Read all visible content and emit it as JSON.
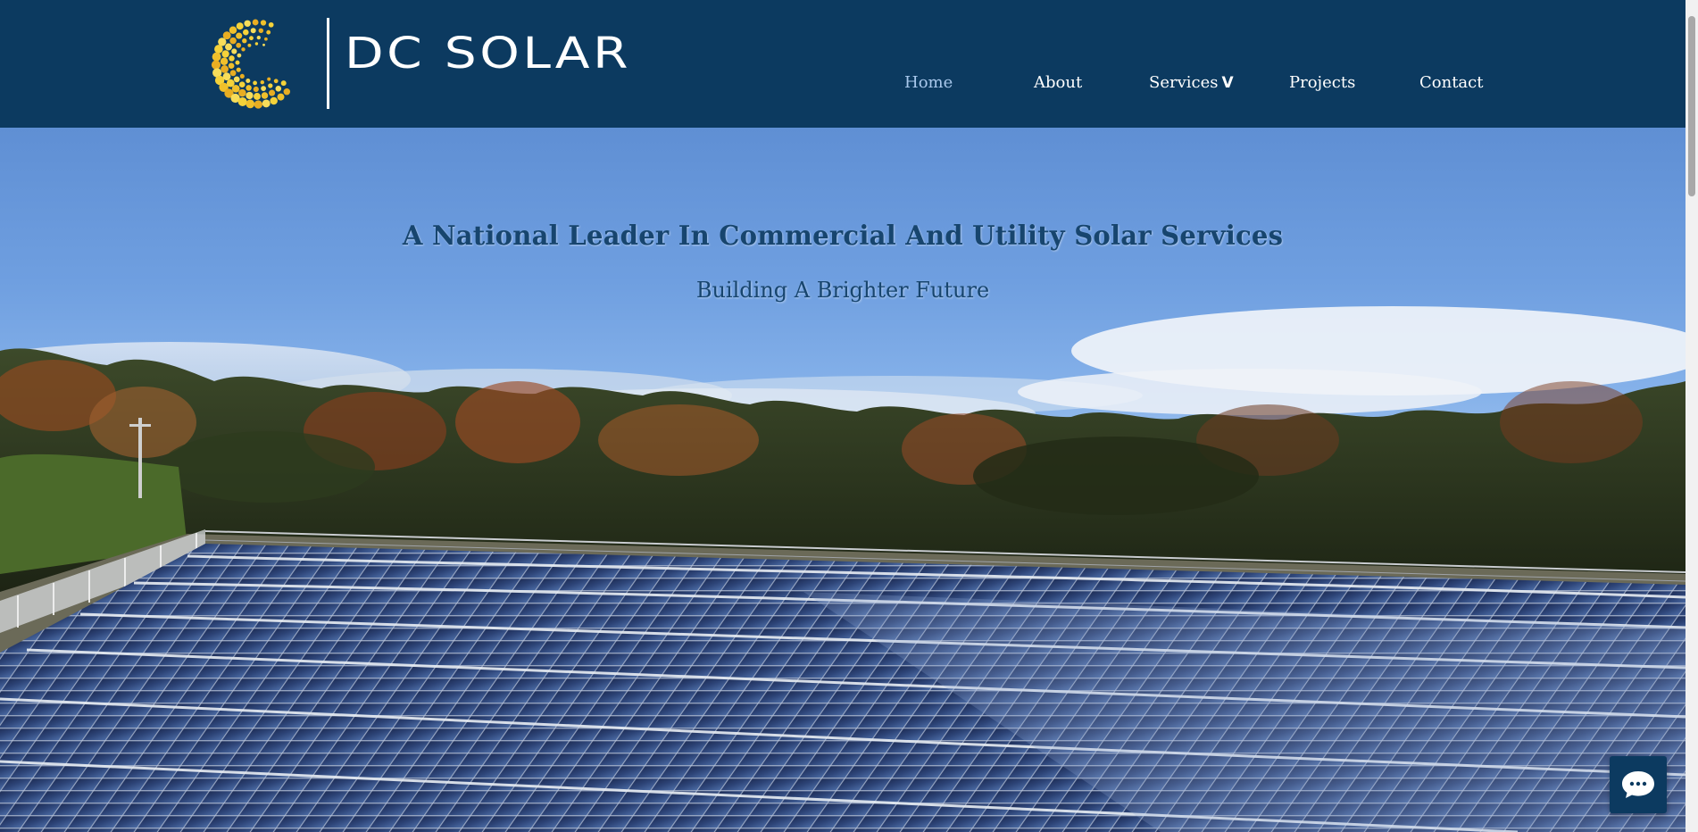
{
  "brand": {
    "name": "DC SOLAR",
    "logo_icon": "sun-dots-logo"
  },
  "nav": {
    "items": [
      {
        "label": "Home",
        "active": true
      },
      {
        "label": "About",
        "active": false
      },
      {
        "label": "Services",
        "active": false,
        "has_dropdown": true,
        "chevron": "V"
      },
      {
        "label": "Projects",
        "active": false
      },
      {
        "label": "Contact",
        "active": false
      }
    ]
  },
  "hero": {
    "title": "A National Leader In Commercial And Utility Solar Services",
    "subtitle": "Building A Brighter Future",
    "background": "solar-farm-photo"
  },
  "chat_widget": {
    "icon": "chat-bubble-icon"
  },
  "colors": {
    "header_bg": "#0c3a60",
    "nav_text": "#ffffff",
    "nav_active": "#a9c8ec",
    "hero_text": "#17456e",
    "logo_gold": "#f2c12e"
  }
}
